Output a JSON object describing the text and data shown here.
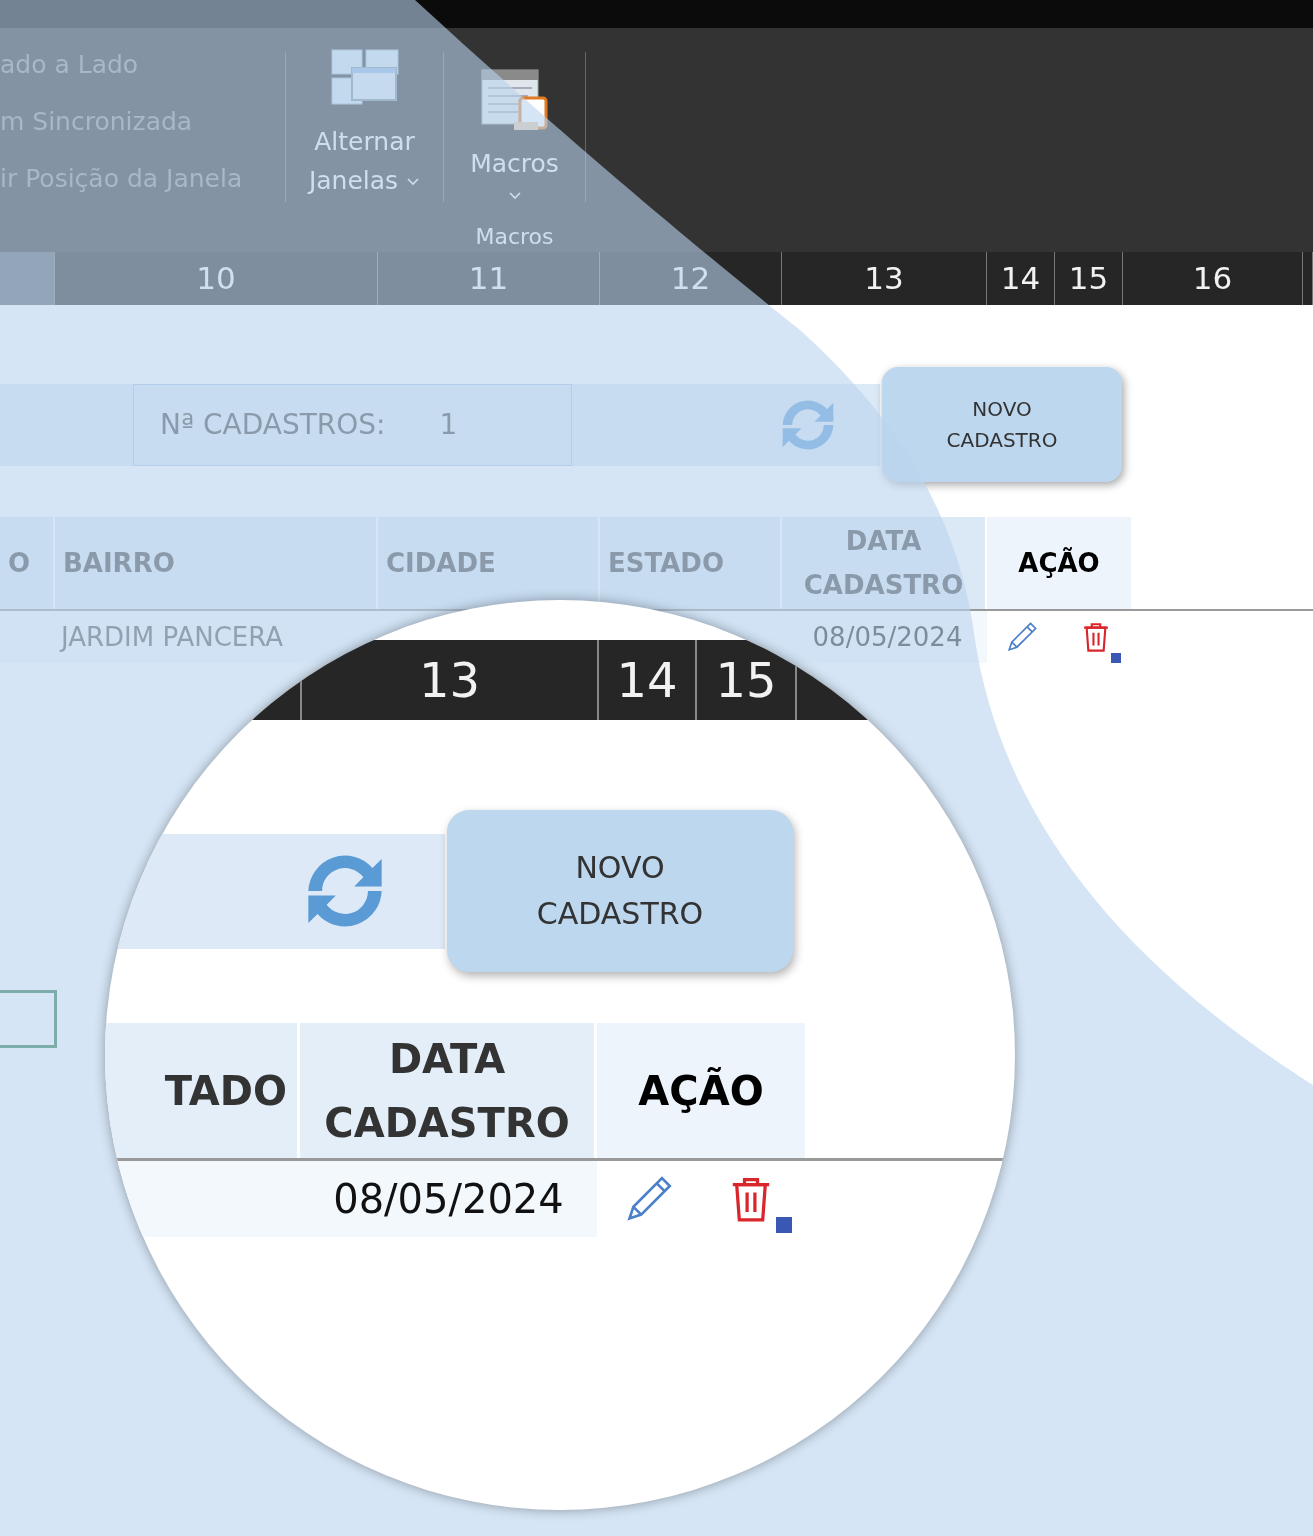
{
  "ribbon": {
    "view_items": [
      {
        "label": "ado a Lado",
        "disabled": true
      },
      {
        "label": "m Sincronizada",
        "disabled": true
      },
      {
        "label": "ir Posição da Janela",
        "disabled": true
      }
    ],
    "switch_button": {
      "line1": "Alternar",
      "line2": "Janelas"
    },
    "macros_button": "Macros",
    "group_label": "Macros"
  },
  "column_headers": [
    {
      "selected": true
    },
    {
      "label": "10",
      "selected": false
    },
    {
      "label": "11",
      "selected": false
    },
    {
      "label": "12",
      "selected": false
    },
    {
      "label": "13",
      "selected": false
    },
    {
      "label": "14",
      "selected": false
    },
    {
      "label": "15",
      "selected": false
    },
    {
      "label": "16",
      "selected": false
    }
  ],
  "form": {
    "count_label": "Nª CADASTROS:",
    "count_value": "1",
    "new_button": "NOVO CADASTRO"
  },
  "table": {
    "columns": [
      "O",
      "BAIRRO",
      "CIDADE",
      "ESTADO",
      "DATA CADASTRO",
      "AÇÃO"
    ],
    "rows": [
      {
        "bairro": "JARDIM PANCERA",
        "date": "08/05/2024"
      }
    ]
  },
  "magnifier": {
    "column_headers": [
      "13",
      "14",
      "15"
    ],
    "new_button": "NOVO CADASTRO",
    "columns": [
      "TADO",
      "DATA CADASTRO",
      "AÇÃO"
    ],
    "rows": [
      {
        "date": "08/05/2024"
      }
    ]
  }
}
